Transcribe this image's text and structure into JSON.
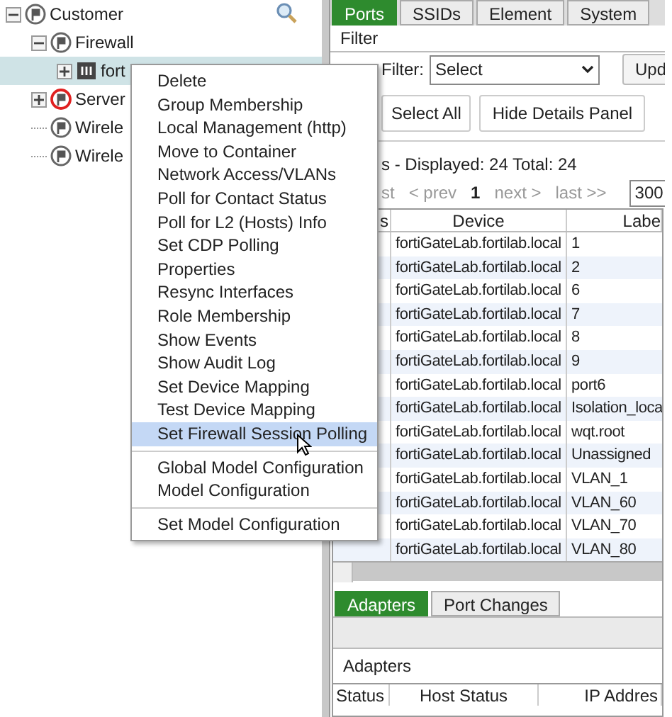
{
  "tree": [
    {
      "label": "Customer",
      "kind": "container",
      "alert": false,
      "expanded": true,
      "children": [
        {
          "label": "Firewall",
          "kind": "container",
          "alert": false,
          "expanded": true,
          "children": [
            {
              "label": "fort",
              "kind": "device",
              "expanded": false,
              "selected": true
            }
          ]
        },
        {
          "label": "Server",
          "kind": "container",
          "alert": true,
          "expanded": false
        },
        {
          "label": "Wirele",
          "kind": "container",
          "alert": false
        },
        {
          "label": "Wirele",
          "kind": "container",
          "alert": false
        }
      ]
    }
  ],
  "tabs": [
    {
      "label": "Ports",
      "selected": true
    },
    {
      "label": "SSIDs",
      "selected": false
    },
    {
      "label": "Element",
      "selected": false
    },
    {
      "label": "System",
      "selected": false
    }
  ],
  "filter": {
    "title": "Filter",
    "label": "Filter:",
    "select": "Select",
    "update_button": "Upd"
  },
  "buttons": [
    "Select All",
    "Hide Details Panel"
  ],
  "summary": "s - Displayed: 24 Total: 24",
  "pager": {
    "first": "st",
    "prev": "< prev",
    "page": "1",
    "next": "next >",
    "last": "last >>",
    "page_size": "300"
  },
  "table": {
    "columns": [
      "s",
      "Device",
      "Labe"
    ],
    "rows": [
      [
        "",
        "fortiGateLab.fortilab.local",
        "1"
      ],
      [
        "",
        "fortiGateLab.fortilab.local",
        "2"
      ],
      [
        "",
        "fortiGateLab.fortilab.local",
        "6"
      ],
      [
        "",
        "fortiGateLab.fortilab.local",
        "7"
      ],
      [
        "",
        "fortiGateLab.fortilab.local",
        "8"
      ],
      [
        "",
        "fortiGateLab.fortilab.local",
        "9"
      ],
      [
        "",
        "fortiGateLab.fortilab.local",
        "port6"
      ],
      [
        "",
        "fortiGateLab.fortilab.local",
        "Isolation_loca"
      ],
      [
        "",
        "fortiGateLab.fortilab.local",
        "wqt.root"
      ],
      [
        "",
        "fortiGateLab.fortilab.local",
        "Unassigned"
      ],
      [
        "",
        "fortiGateLab.fortilab.local",
        "VLAN_1"
      ],
      [
        "",
        "fortiGateLab.fortilab.local",
        "VLAN_60"
      ],
      [
        "",
        "fortiGateLab.fortilab.local",
        "VLAN_70"
      ],
      [
        "",
        "fortiGateLab.fortilab.local",
        "VLAN_80"
      ]
    ]
  },
  "bottom_tabs": [
    {
      "label": "Adapters",
      "selected": true
    },
    {
      "label": "Port Changes",
      "selected": false
    }
  ],
  "adapters": {
    "title": "Adapters",
    "columns": [
      "Status",
      "Host Status",
      "IP Addres"
    ]
  },
  "menu": [
    [
      {
        "label": "Delete",
        "selected": false
      },
      {
        "label": "Group Membership",
        "selected": false
      },
      {
        "label": "Local Management (http)",
        "selected": false
      },
      {
        "label": "Move to Container",
        "selected": false
      },
      {
        "label": "Network Access/VLANs",
        "selected": false
      },
      {
        "label": "Poll for Contact Status",
        "selected": false
      },
      {
        "label": "Poll for L2 (Hosts) Info",
        "selected": false
      },
      {
        "label": "Set CDP Polling",
        "selected": false
      },
      {
        "label": "Properties",
        "selected": false
      },
      {
        "label": "Resync Interfaces",
        "selected": false
      },
      {
        "label": "Role Membership",
        "selected": false
      },
      {
        "label": "Show Events",
        "selected": false
      },
      {
        "label": "Show Audit Log",
        "selected": false
      },
      {
        "label": "Set Device Mapping",
        "selected": false
      },
      {
        "label": "Test Device Mapping",
        "selected": false
      },
      {
        "label": "Set Firewall Session Polling",
        "selected": true
      }
    ],
    [
      {
        "label": "Global Model Configuration",
        "selected": false
      },
      {
        "label": "Model Configuration",
        "selected": false
      }
    ],
    [
      {
        "label": "Set Model Configuration",
        "selected": false
      }
    ]
  ]
}
